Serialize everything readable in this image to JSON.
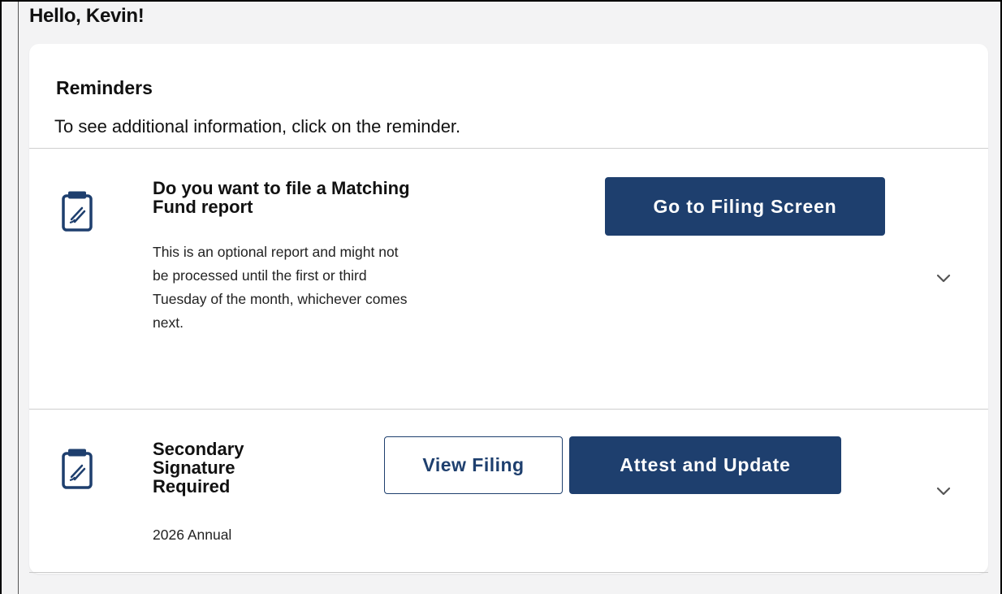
{
  "greeting": "Hello, Kevin!",
  "reminders": {
    "title": "Reminders",
    "subtitle": "To see additional information, click on the reminder.",
    "items": [
      {
        "icon": "clipboard-pen-icon",
        "title": "Do you want to file a Matching Fund report",
        "description": "This is an optional report and might not be processed until the first or third Tuesday of the month, whichever comes next.",
        "actions": [
          "Go to Filing Screen"
        ],
        "expand_icon": "chevron-down-icon"
      },
      {
        "icon": "clipboard-pen-icon",
        "title": "Secondary Signature Required",
        "description": "2026 Annual",
        "actions": [
          "View Filing",
          "Attest and Update"
        ],
        "expand_icon": "chevron-down-icon"
      }
    ]
  },
  "colors": {
    "primary": "#1e3f6e",
    "background": "#f3f3f4",
    "card": "#ffffff"
  }
}
